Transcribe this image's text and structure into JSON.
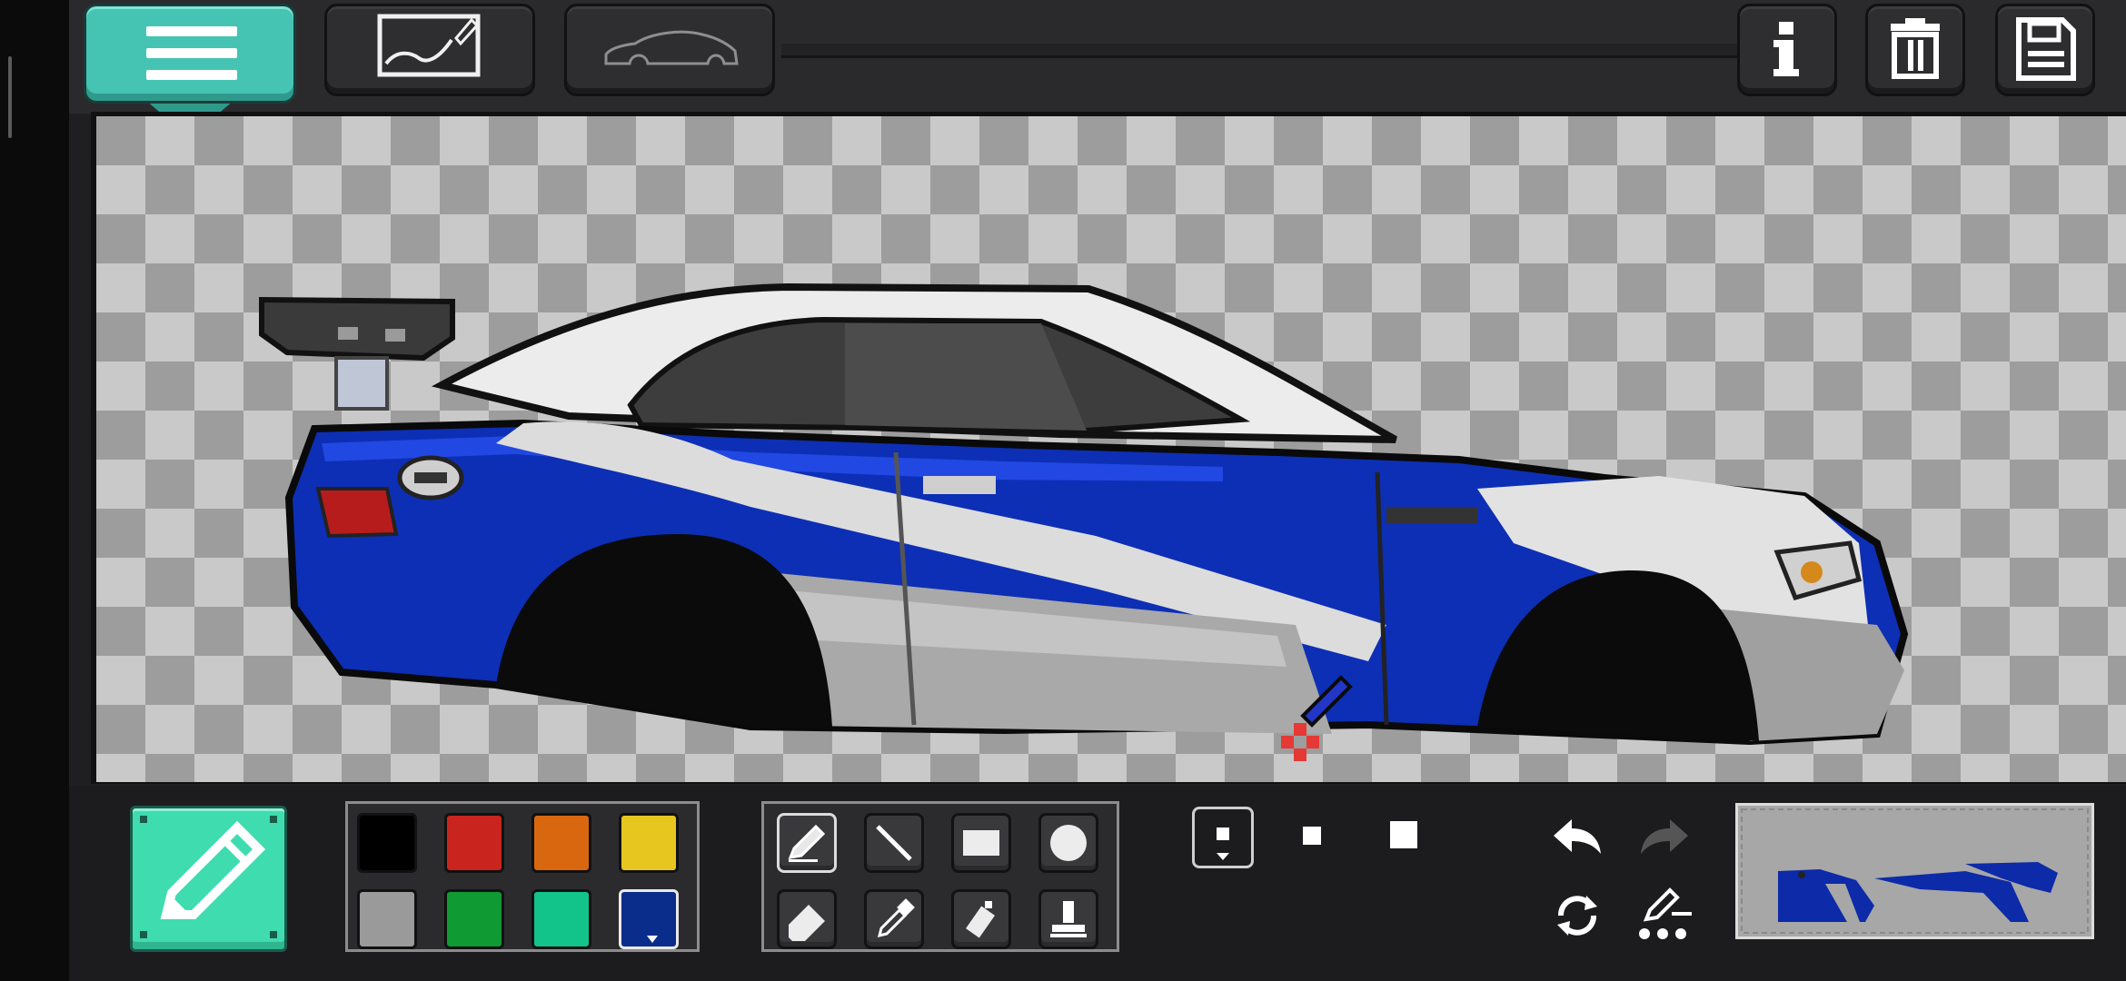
{
  "app": {
    "accent": "#45c4b4",
    "tool_accent": "#3fdcb0"
  },
  "top_toolbar": {
    "left_buttons": [
      {
        "name": "menu",
        "icon": "hamburger-menu-icon"
      },
      {
        "name": "sketch-layer",
        "icon": "sketch-canvas-icon"
      },
      {
        "name": "car-outline",
        "icon": "car-outline-icon"
      }
    ],
    "right_buttons": [
      {
        "name": "info",
        "icon": "info-icon"
      },
      {
        "name": "delete",
        "icon": "trash-icon"
      },
      {
        "name": "save",
        "icon": "floppy-disk-icon"
      }
    ]
  },
  "canvas": {
    "background": "transparency-checkerboard",
    "content": "pixel-art-car-livery"
  },
  "bottom_toolbar": {
    "active_tool": "pencil",
    "palette": {
      "colors": [
        "#000000",
        "#c9241d",
        "#d9670f",
        "#e7c61f",
        "#9a9a9a",
        "#0f9a33",
        "#12c48a",
        "#0a2d8c"
      ],
      "selected_index": 7
    },
    "tools": [
      {
        "name": "pencil",
        "icon": "pencil-icon",
        "selected": true
      },
      {
        "name": "line",
        "icon": "line-icon",
        "selected": false
      },
      {
        "name": "rectangle",
        "icon": "rectangle-icon",
        "selected": false
      },
      {
        "name": "circle",
        "icon": "circle-icon",
        "selected": false
      },
      {
        "name": "eraser",
        "icon": "eraser-icon",
        "selected": false
      },
      {
        "name": "eyedropper",
        "icon": "eyedropper-icon",
        "selected": false
      },
      {
        "name": "spray",
        "icon": "spray-can-icon",
        "selected": false
      },
      {
        "name": "stamp",
        "icon": "stamp-icon",
        "selected": false
      }
    ],
    "brush_sizes": [
      "small",
      "medium",
      "large"
    ],
    "selected_brush_size": "small",
    "history": [
      {
        "name": "undo",
        "icon": "undo-arrow-icon",
        "enabled": true
      },
      {
        "name": "redo",
        "icon": "redo-arrow-icon",
        "enabled": false
      }
    ],
    "extra": [
      {
        "name": "refresh",
        "icon": "refresh-icon"
      },
      {
        "name": "pencil-settings",
        "icon": "pencil-settings-icon"
      }
    ]
  }
}
